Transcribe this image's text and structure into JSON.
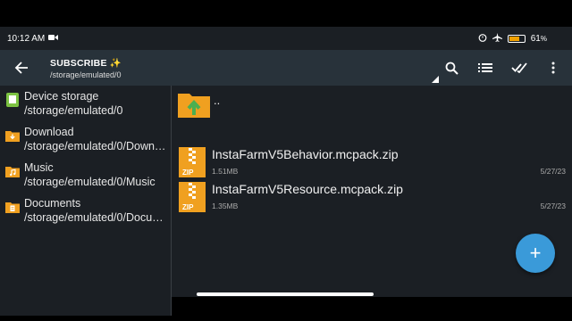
{
  "status": {
    "time": "10:12 AM",
    "battery": "61",
    "battery_unit": "%",
    "battery_level": 0.61
  },
  "toolbar": {
    "title": "SUBSCRIBE ✨",
    "path": "/storage/emulated/0"
  },
  "sidebar": {
    "items": [
      {
        "label": "Device storage",
        "path": "/storage/emulated/0",
        "icon": "device-storage-icon"
      },
      {
        "label": "Download",
        "path": "/storage/emulated/0/Down…",
        "icon": "download-folder-icon"
      },
      {
        "label": "Music",
        "path": "/storage/emulated/0/Music",
        "icon": "music-folder-icon"
      },
      {
        "label": "Documents",
        "path": "/storage/emulated/0/Docu…",
        "icon": "documents-folder-icon"
      }
    ]
  },
  "files": {
    "parent_label": "..",
    "items": [
      {
        "name": "InstaFarmV5Behavior.mcpack.zip",
        "size": "1.51MB",
        "date": "5/27/23",
        "icon": "zip-icon"
      },
      {
        "name": "InstaFarmV5Resource.mcpack.zip",
        "size": "1.35MB",
        "date": "5/27/23",
        "icon": "zip-icon"
      }
    ]
  },
  "fab": {
    "label": "+"
  },
  "colors": {
    "toolbar": "#28323a",
    "background": "#1b1f24",
    "folder": "#f0a020",
    "fab": "#3a9ad9"
  }
}
